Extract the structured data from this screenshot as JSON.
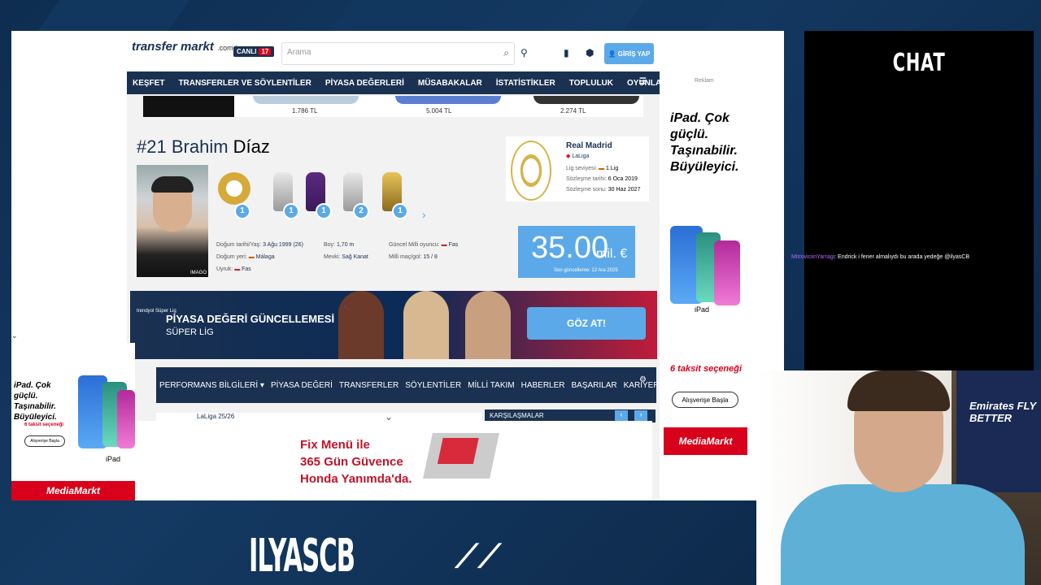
{
  "tm": {
    "logo": "transfer markt",
    "domain": ".com.tr",
    "live_label": "CANLI",
    "live_count": "17",
    "search_placeholder": "Arama",
    "login_label": "GİRİŞ YAP",
    "nav": [
      "KEŞFET",
      "TRANSFERLER VE SÖYLENTİLER",
      "PİYASA DEĞERLERİ",
      "MÜSABAKALAR",
      "İSTATİSTİKLER",
      "TOPLULUK",
      "OYUNLAR"
    ],
    "shoe_prices": [
      "1.786 TL",
      "5.004 TL",
      "2.274 TL"
    ],
    "player_number": "#21",
    "player_first": "Brahim",
    "player_last": "Díaz",
    "photo_credit": "IMAGO",
    "trophy_counts": [
      "1",
      "1",
      "1",
      "2",
      "1"
    ],
    "info_col1": {
      "l1": "Doğum tarihi/Yaş:",
      "v1": "3 Ağu 1999 (26)",
      "l2": "Doğum yeri:",
      "v2": "Málaga",
      "l3": "Uyruk:",
      "v3": "Fas"
    },
    "info_col2": {
      "l1": "Boy:",
      "v1": "1,70 m",
      "l2": "Mevki:",
      "v2": "Sağ Kanat"
    },
    "info_col3": {
      "l1": "Güncel Milli oyuncu:",
      "v1": "Fas",
      "l2": "Milli maç/gol:",
      "v2": "15 / 8"
    },
    "club": {
      "name": "Real Madrid",
      "league": "LaLiga",
      "level_label": "Lig seviyesi:",
      "level_value": "1.Lig",
      "joined_label": "Sözleşme tarihi:",
      "joined_value": "6 Oca 2019",
      "expires_label": "Sözleşme sonu:",
      "expires_value": "30 Haz 2027"
    },
    "market_value": "35.00",
    "market_unit": "mil. €",
    "market_updated": "Son güncelleme: 12 Ara 2025",
    "banner": {
      "brand": "trendyol Süper Lig",
      "title": "PİYASA DEĞERİ GÜNCELLEMESİ",
      "subtitle": "SÜPER LİG",
      "cta": "GÖZ AT!"
    },
    "subnav": [
      "PERFORMANS BİLGİLERİ ▾",
      "PİYASA DEĞERİ",
      "TRANSFERLER",
      "SÖYLENTİLER",
      "MİLLİ TAKIM",
      "HABERLER",
      "BAŞARILAR",
      "KARİYER ▾"
    ],
    "laliga_label": "LaLiga 25/26",
    "karsilasmalar": "KARŞILAŞMALAR"
  },
  "ads": {
    "reklam": "Reklam",
    "right_headline": "iPad. Çok güçlü. Taşınabilir. Büyüleyici.",
    "right_ipad": "iPad",
    "right_taksit": "6 taksit seçeneği",
    "right_button": "Alışverişe Başla",
    "mediamarkt": "MediaMarkt",
    "left_headline": "iPad. Çok güçlü. Taşınabilir. Büyüleyici.",
    "left_taksit": "6 taksit seçeneği",
    "left_button": "Alışverişe Başla",
    "left_ipad": "iPad",
    "bottom_line1": "Fix Menü ile",
    "bottom_line2": "365 Gün Güvence",
    "bottom_line3": "Honda Yanımda'da."
  },
  "chat": {
    "title": "CHAT",
    "user": "MitroviciinYarragi",
    "message": ": Endrick i fener almalıydı bu arada yedeğe @ilyasCB"
  },
  "stream": {
    "streamer": "ILYASCB",
    "logo": "ↈ",
    "jersey_text": "Emirates FLY BETTER"
  }
}
